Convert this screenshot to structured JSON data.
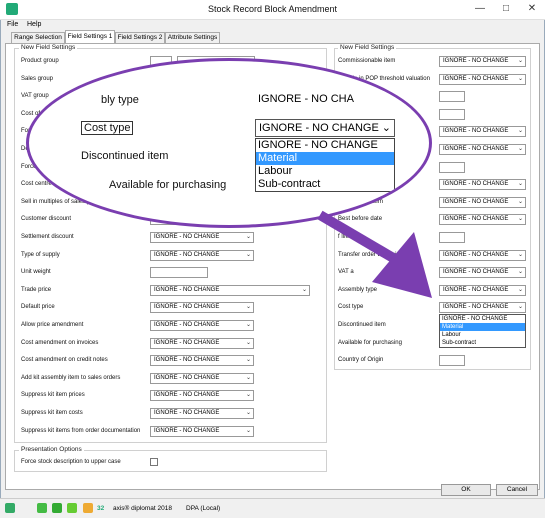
{
  "window": {
    "title": "Stock Record Block Amendment",
    "controls": [
      "—",
      "□",
      "✕"
    ]
  },
  "menu": [
    "File",
    "Help"
  ],
  "tabs": [
    "Range Selection",
    "Field Settings 1",
    "Field Settings 2",
    "Attribute Settings"
  ],
  "left_group": {
    "title": "New Field Settings",
    "rows": [
      {
        "label": "Product group",
        "type": "code"
      },
      {
        "label": "Sales group",
        "type": "code"
      },
      {
        "label": "VAT group",
        "type": "select",
        "value": "IGNORE - NO CHANGE"
      },
      {
        "label": "Cost of sales",
        "type": "select",
        "value": "IGNORE - NO CHANGE"
      },
      {
        "label": "Force",
        "type": "select",
        "value": "IGNORE - NO CHANGE"
      },
      {
        "label": "Def",
        "type": "select",
        "value": "IGNORE - NO CHANGE"
      },
      {
        "label": "Force re",
        "type": "select",
        "value": "IGNORE - NO CHANGE"
      },
      {
        "label": "Cost centre",
        "type": "select",
        "value": "IGNORE - NO CHANGE"
      },
      {
        "label": "Sell in multiples of sales per",
        "type": "select",
        "value": "IGNORE - NO CHANGE"
      },
      {
        "label": "Customer discount",
        "type": "select",
        "value": "IGNORE - NO CHANGE"
      },
      {
        "label": "Settlement discount",
        "type": "select",
        "value": "IGNORE - NO CHANGE"
      },
      {
        "label": "Type of supply",
        "type": "select",
        "value": "IGNORE - NO CHANGE"
      },
      {
        "label": "Unit weight",
        "type": "text"
      },
      {
        "label": "Trade price",
        "type": "wide",
        "value": "IGNORE - NO CHANGE"
      },
      {
        "label": "Default price",
        "type": "select",
        "value": "IGNORE - NO CHANGE"
      },
      {
        "label": "Allow price amendment",
        "type": "select",
        "value": "IGNORE - NO CHANGE"
      },
      {
        "label": "Cost amendment on invoices",
        "type": "select",
        "value": "IGNORE - NO CHANGE"
      },
      {
        "label": "Cost amendment on credit notes",
        "type": "select",
        "value": "IGNORE - NO CHANGE"
      },
      {
        "label": "Add kit assembly item to sales orders",
        "type": "select",
        "value": "IGNORE - NO CHANGE"
      },
      {
        "label": "Suppress kit item prices",
        "type": "select",
        "value": "IGNORE - NO CHANGE"
      },
      {
        "label": "Suppress kit item costs",
        "type": "select",
        "value": "IGNORE - NO CHANGE"
      },
      {
        "label": "Suppress kit items from order documentation",
        "type": "select",
        "value": "IGNORE - NO CHANGE"
      }
    ]
  },
  "presentation": {
    "title": "Presentation Options",
    "label": "Force stock description to upper case"
  },
  "right_group": {
    "title": "New Field Settings",
    "rows": [
      {
        "label": "Commissionable item",
        "type": "select",
        "value": "IGNORE - NO CHANGE"
      },
      {
        "label": "Include in POP threshold valuation",
        "type": "select",
        "value": "IGNORE - NO CHANGE"
      },
      {
        "label": "lead time (days)",
        "type": "text"
      },
      {
        "label": "tomer (days)",
        "type": "text"
      },
      {
        "label": "",
        "type": "select",
        "value": "IGNORE - NO CHANGE"
      },
      {
        "label": "",
        "type": "select",
        "value": "IGNORE - NO CHANGE"
      },
      {
        "label": "",
        "type": "text"
      },
      {
        "label": "mat",
        "type": "select",
        "value": "IGNORE - NO CHANGE"
      },
      {
        "label": "Re-saleable item",
        "type": "select",
        "value": "IGNORE - NO CHANGE"
      },
      {
        "label": "Best before date",
        "type": "select",
        "value": "IGNORE - NO CHANGE"
      },
      {
        "label": "f life",
        "type": "text"
      },
      {
        "label": "Transfer order to invoice",
        "type": "select",
        "value": "IGNORE - NO CHANGE"
      },
      {
        "label": "VAT a",
        "type": "select",
        "value": "IGNORE - NO CHANGE"
      },
      {
        "label": "Assembly type",
        "type": "select",
        "value": "IGNORE - NO CHANGE"
      },
      {
        "label": "Cost type",
        "type": "select",
        "value": "IGNORE - NO CHANGE"
      },
      {
        "label": "Discontinued item",
        "type": "none"
      },
      {
        "label": "Available for purchasing",
        "type": "none"
      },
      {
        "label": "Country of Origin",
        "type": "text"
      }
    ],
    "dropdown_options": [
      "IGNORE - NO CHANGE",
      "Material",
      "Labour",
      "Sub-contract"
    ],
    "dropdown_highlight": 1
  },
  "lens": {
    "rows": [
      {
        "label": "bly type",
        "value": "IGNORE - NO CHA"
      },
      {
        "label": "Cost type",
        "value": "IGNORE - NO CHANGE"
      },
      {
        "label": "Discontinued item"
      },
      {
        "label": "Available for purchasing"
      }
    ],
    "options": [
      "IGNORE - NO CHANGE",
      "Material",
      "Labour",
      "Sub-contract"
    ],
    "highlight": 1
  },
  "buttons": {
    "ok": "OK",
    "cancel": "Cancel"
  },
  "status": {
    "count": "32",
    "product": "axis® diplomat 2018",
    "company": "DPA (Local)"
  },
  "colors": {
    "arrow": "#7a3eb0",
    "highlight": "#3399ff"
  }
}
